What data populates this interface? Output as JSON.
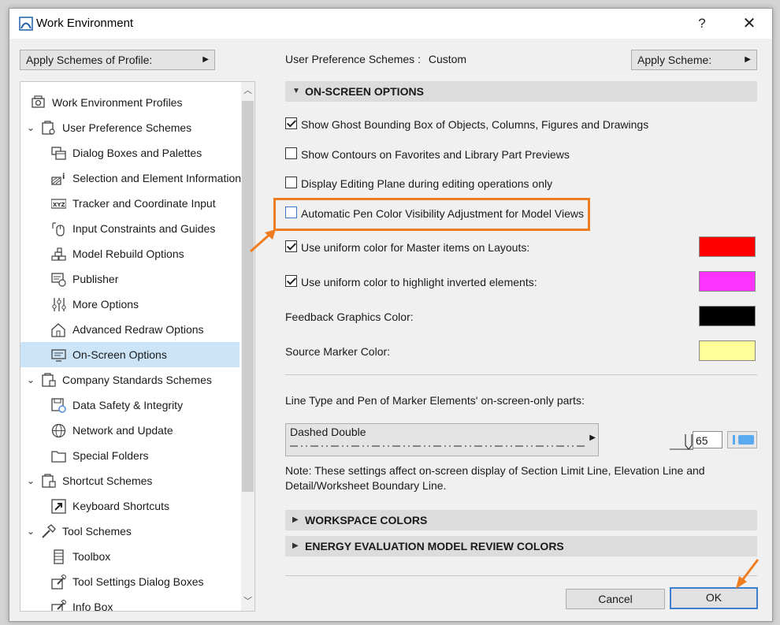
{
  "window": {
    "title": "Work Environment",
    "help": "?",
    "close": "✕"
  },
  "top": {
    "apply_profile": "Apply Schemes of Profile:",
    "scheme_label": "User Preference Schemes :",
    "scheme_value": "Custom",
    "apply_scheme": "Apply Scheme:"
  },
  "tree": [
    {
      "label": "Work Environment Profiles",
      "icon": "profiles-icon"
    },
    {
      "label": "User Preference Schemes",
      "icon": "user-prefs-icon"
    },
    {
      "label": "Dialog Boxes and Palettes",
      "icon": "dialog-boxes-icon"
    },
    {
      "label": "Selection and Element Information",
      "icon": "selection-icon"
    },
    {
      "label": "Tracker and Coordinate Input",
      "icon": "xyz-icon"
    },
    {
      "label": "Input Constraints and Guides",
      "icon": "mouse-icon"
    },
    {
      "label": "Model Rebuild Options",
      "icon": "bricks-icon"
    },
    {
      "label": "Publisher",
      "icon": "publisher-icon"
    },
    {
      "label": "More Options",
      "icon": "sliders-icon"
    },
    {
      "label": "Advanced Redraw Options",
      "icon": "house-icon"
    },
    {
      "label": "On-Screen Options",
      "icon": "monitor-icon"
    },
    {
      "label": "Company Standards Schemes",
      "icon": "company-icon"
    },
    {
      "label": "Data Safety & Integrity",
      "icon": "data-safety-icon"
    },
    {
      "label": "Network and Update",
      "icon": "globe-icon"
    },
    {
      "label": "Special Folders",
      "icon": "folder-icon"
    },
    {
      "label": "Shortcut Schemes",
      "icon": "shortcut-scheme-icon"
    },
    {
      "label": "Keyboard Shortcuts",
      "icon": "arrow-shortcut-icon"
    },
    {
      "label": "Tool Schemes",
      "icon": "tool-scheme-icon"
    },
    {
      "label": "Toolbox",
      "icon": "toolbox-icon"
    },
    {
      "label": "Tool Settings Dialog Boxes",
      "icon": "tool-settings-icon"
    },
    {
      "label": "Info Box",
      "icon": "info-box-icon"
    }
  ],
  "onscreen": {
    "header": "ON-SCREEN OPTIONS",
    "options": [
      {
        "label": "Show Ghost Bounding Box of Objects, Columns, Figures and Drawings",
        "checked": true
      },
      {
        "label": "Show Contours on Favorites and Library Part Previews",
        "checked": false
      },
      {
        "label": "Display Editing Plane during editing operations only",
        "checked": false
      },
      {
        "label": "Automatic Pen Color Visibility Adjustment for Model Views",
        "checked": false
      },
      {
        "label": "Use uniform color for Master items on Layouts:",
        "checked": true,
        "color": "#ff0000"
      },
      {
        "label": "Use uniform color to highlight inverted elements:",
        "checked": true,
        "color": "#ff33ff"
      }
    ],
    "feedback_label": "Feedback Graphics Color:",
    "feedback_color": "#000000",
    "source_label": "Source Marker Color:",
    "source_color": "#ffff99",
    "line_type_label": "Line Type and Pen of Marker Elements' on-screen-only parts:",
    "line_type_value": "Dashed Double",
    "pen_number": "65",
    "pen_color": "#5aaaf0",
    "note": "Note: These settings affect on-screen display of Section Limit Line, Elevation Line and Detail/Worksheet Boundary Line."
  },
  "sections": {
    "workspace": "WORKSPACE COLORS",
    "energy": "ENERGY EVALUATION MODEL REVIEW COLORS"
  },
  "buttons": {
    "cancel": "Cancel",
    "ok": "OK"
  },
  "colors": {
    "highlight": "#ef7d1f",
    "selected": "#cce4f7"
  }
}
